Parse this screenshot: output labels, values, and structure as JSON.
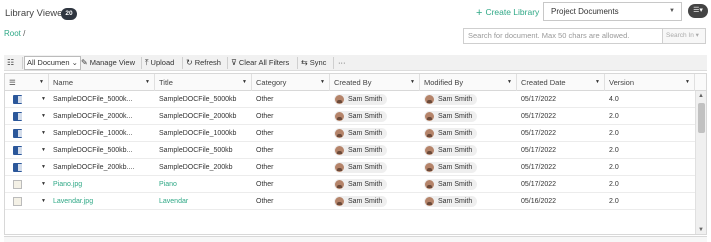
{
  "header": {
    "title": "Library Viewer",
    "count": "20",
    "create_library": "Create Library",
    "library_select": "Project Documents",
    "menu_icon": "list-icon"
  },
  "breadcrumb": {
    "root": "Root",
    "separator": "/"
  },
  "search": {
    "placeholder": "Search for document. Max 50 chars are allowed.",
    "search_in": "Search In ▾"
  },
  "toolbar": {
    "view_select": "All Documen",
    "manage_view": "Manage View",
    "upload": "Upload",
    "refresh": "Refresh",
    "clear_filters": "Clear All Filters",
    "sync": "Sync",
    "more": "···"
  },
  "columns": [
    "Name",
    "Title",
    "Category",
    "Created By",
    "Modified By",
    "Created Date",
    "Version"
  ],
  "rows": [
    {
      "type": "doc",
      "name": "SampleDOCFile_5000k...",
      "title": "SampleDOCFile_5000kb",
      "category": "Other",
      "created_by": "Sam Smith",
      "modified_by": "Sam Smith",
      "created_date": "05/17/2022",
      "version": "4.0"
    },
    {
      "type": "doc",
      "name": "SampleDOCFile_2000k...",
      "title": "SampleDOCFile_2000kb",
      "category": "Other",
      "created_by": "Sam Smith",
      "modified_by": "Sam Smith",
      "created_date": "05/17/2022",
      "version": "2.0"
    },
    {
      "type": "doc",
      "name": "SampleDOCFile_1000k...",
      "title": "SampleDOCFile_1000kb",
      "category": "Other",
      "created_by": "Sam Smith",
      "modified_by": "Sam Smith",
      "created_date": "05/17/2022",
      "version": "2.0"
    },
    {
      "type": "doc",
      "name": "SampleDOCFile_500kb...",
      "title": "SampleDOCFile_500kb",
      "category": "Other",
      "created_by": "Sam Smith",
      "modified_by": "Sam Smith",
      "created_date": "05/17/2022",
      "version": "2.0"
    },
    {
      "type": "doc",
      "name": "SampleDOCFile_200kb....",
      "title": "SampleDOCFile_200kb",
      "category": "Other",
      "created_by": "Sam Smith",
      "modified_by": "Sam Smith",
      "created_date": "05/17/2022",
      "version": "2.0"
    },
    {
      "type": "image",
      "name": "Piano.jpg",
      "title": "Piano",
      "category": "Other",
      "created_by": "Sam Smith",
      "modified_by": "Sam Smith",
      "created_date": "05/17/2022",
      "version": "2.0"
    },
    {
      "type": "image",
      "name": "Lavendar.jpg",
      "title": "Lavendar",
      "category": "Other",
      "created_by": "Sam Smith",
      "modified_by": "Sam Smith",
      "created_date": "05/16/2022",
      "version": "2.0"
    }
  ],
  "colors": {
    "accent": "#2fa886",
    "badge": "#2f3640",
    "doc_icon": "#2b579a"
  }
}
